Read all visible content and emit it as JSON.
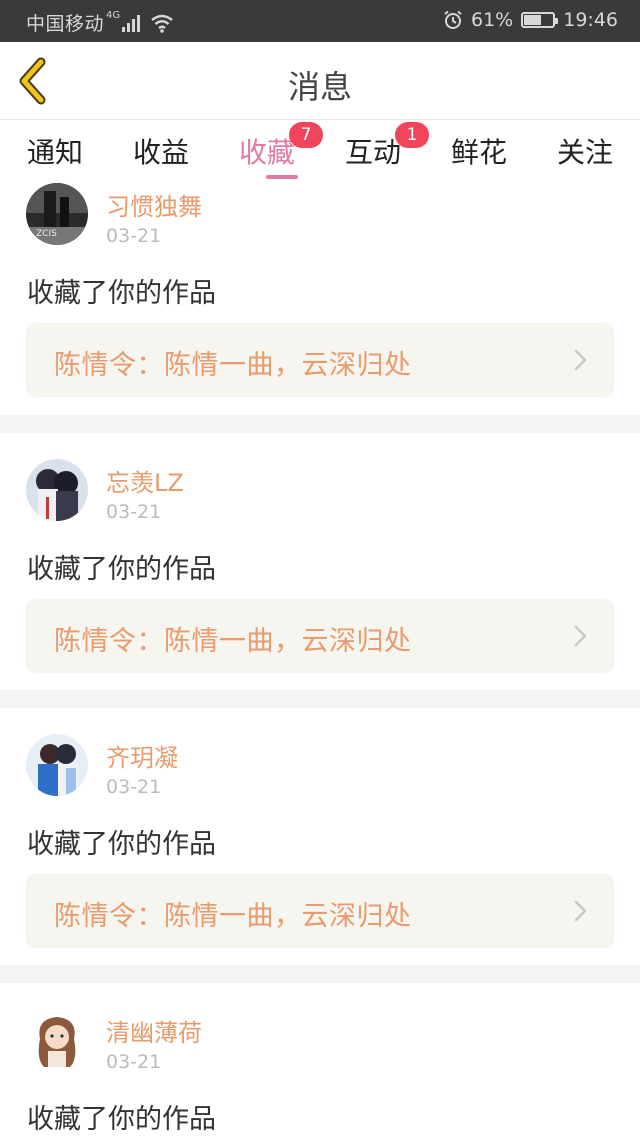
{
  "status_bar": {
    "carrier": "中国移动",
    "network": "4G",
    "battery_percent": "61%",
    "battery_level": 0.61,
    "time": "19:46",
    "icons": [
      "signal-icon",
      "wifi-icon",
      "alarm-icon",
      "battery-icon"
    ]
  },
  "header": {
    "title": "消息",
    "back_icon": "chevron-left-icon"
  },
  "tabs": [
    {
      "label": "通知",
      "badge": ""
    },
    {
      "label": "收益",
      "badge": ""
    },
    {
      "label": "收藏",
      "badge": "7",
      "active": true
    },
    {
      "label": "互动",
      "badge": "1"
    },
    {
      "label": "鲜花",
      "badge": ""
    },
    {
      "label": "关注",
      "badge": ""
    }
  ],
  "items": [
    {
      "username": "习惯独舞",
      "date": "03-21",
      "action": "收藏了你的作品",
      "work_title": "陈情令：陈情一曲，云深归处"
    },
    {
      "username": "忘羡LZ",
      "date": "03-21",
      "action": "收藏了你的作品",
      "work_title": "陈情令：陈情一曲，云深归处"
    },
    {
      "username": "齐玥凝",
      "date": "03-21",
      "action": "收藏了你的作品",
      "work_title": "陈情令：陈情一曲，云深归处"
    },
    {
      "username": "清幽薄荷",
      "date": "03-21",
      "action": "收藏了你的作品",
      "work_title": ""
    }
  ],
  "colors": {
    "accent": "#e07aa8",
    "username": "#e89b6c",
    "badge": "#f0455a",
    "back_arrow": "#f0c419",
    "card_bg": "#f6f5ef"
  }
}
